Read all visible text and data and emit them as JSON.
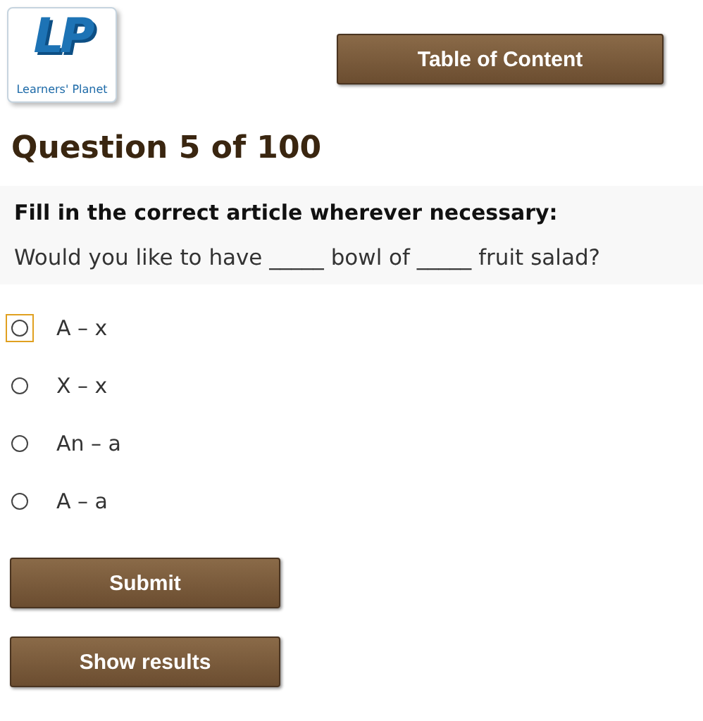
{
  "logo": {
    "mark": "LP",
    "text": "Learners' Planet"
  },
  "toc_button": "Table of Content",
  "heading": "Question 5 of 100",
  "instruction": "Fill in the correct article wherever necessary:",
  "question": "Would you like to have _____ bowl of _____ fruit salad?",
  "options": [
    {
      "label": "A – x",
      "selected": false,
      "focused": true
    },
    {
      "label": "X – x",
      "selected": false,
      "focused": false
    },
    {
      "label": "An – a",
      "selected": false,
      "focused": false
    },
    {
      "label": "A – a",
      "selected": false,
      "focused": false
    }
  ],
  "buttons": [
    "Submit",
    "Show results"
  ]
}
